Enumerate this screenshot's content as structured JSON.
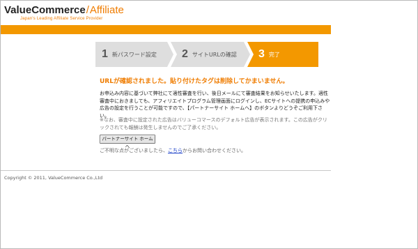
{
  "header": {
    "brand": "ValueCommerce",
    "slash": "/",
    "product": "Affiliate",
    "tagline": "Japan's Leading Affiliate Service Provider"
  },
  "steps": [
    {
      "num": "1",
      "label": "新パスワード設定"
    },
    {
      "num": "2",
      "label": "サイトURLの確認"
    },
    {
      "num": "3",
      "label": "完了"
    }
  ],
  "main": {
    "title": "URLが確認されました。貼り付けたタグは削除してかまいません。",
    "body": "お申込み内容に基づいて弊社にて適性審査を行い、後日メールにて審査結果をお知らせいたします。適性審査中におきましても、アフィリエイトプログラム管理画面にログインし、ECサイトへの提携の申込みや広告の設定を行うことが可能ですので、【パートナーサイト ホームへ】のボタンよりどうぞご利用下さい。",
    "note": "※なお、審査中に設定された広告はバリューコマースのデフォルト広告が表示されます。この広告がクリックされても報酬は発生しませんのでご了承ください。",
    "button_label": "パートナーサイト ホームへ",
    "contact_prefix": "ご不明な点がございましたら、",
    "contact_link": "こちら",
    "contact_suffix": "からお問い合わせください。"
  },
  "footer": {
    "copyright": "Copyright © 2011, ValueCommerce Co.,Ltd"
  },
  "colors": {
    "accent": "#f39800",
    "step_inactive": "#dedede",
    "link": "#1a3fc8"
  }
}
